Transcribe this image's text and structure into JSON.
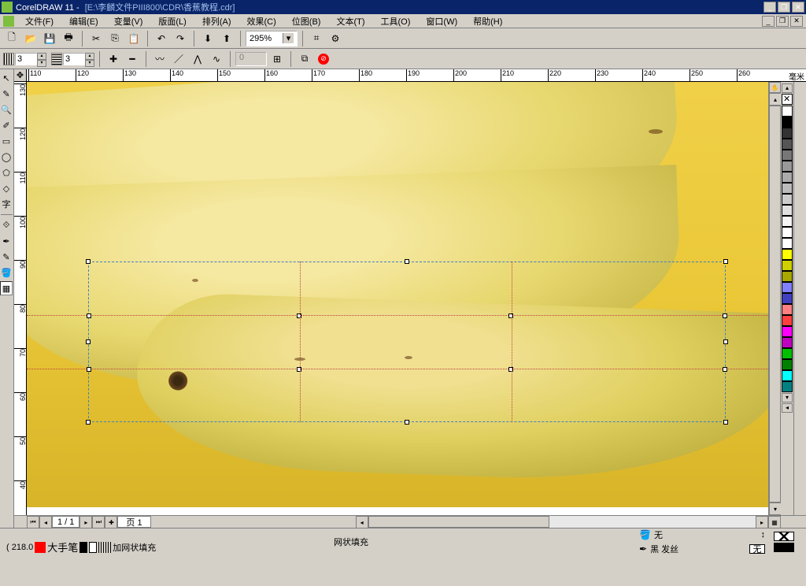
{
  "app": {
    "name": "CorelDRAW 11",
    "document_path": "[E:\\李麟文件PIII800\\CDR\\香蕉教程.cdr]"
  },
  "menu": {
    "items": [
      "文件(F)",
      "编辑(E)",
      "变量(V)",
      "版面(L)",
      "排列(A)",
      "效果(C)",
      "位图(B)",
      "文本(T)",
      "工具(O)",
      "窗口(W)",
      "帮助(H)"
    ]
  },
  "toolbar1": {
    "zoom": "295%"
  },
  "toolbar2": {
    "grid_a": "3",
    "grid_b": "3",
    "coord": "0"
  },
  "ruler": {
    "unit": "毫米",
    "h_ticks": [
      110,
      120,
      130,
      140,
      150,
      160,
      170,
      180,
      190,
      200,
      210,
      220,
      230,
      240,
      250,
      260
    ],
    "v_ticks": [
      130,
      120,
      110,
      100,
      90,
      80,
      70,
      60,
      50,
      40
    ]
  },
  "nav": {
    "page_current": "1",
    "page_total": "1",
    "page_tab": "页 1"
  },
  "status": {
    "coord": "( 218.0",
    "bigtext": "大手笔",
    "meshfill_label": "加网状填充",
    "center": "网状填充",
    "fill": "无",
    "outline": "黑 发丝",
    "outline_box": "无"
  },
  "palette": {
    "colors": [
      "#FFFFFF",
      "#000000",
      "#333333",
      "#555555",
      "#777777",
      "#999999",
      "#AAAAAA",
      "#BBBBBB",
      "#CCCCCC",
      "#E0E0E0",
      "#F5F5F5",
      "#FFFFFF",
      "#FFFFFF",
      "#FFFF00",
      "#D0D000",
      "#A8A800",
      "#8080FF",
      "#4040C0",
      "#FF8080",
      "#FF4040",
      "#FF00FF",
      "#C000C0",
      "#00C000",
      "#008000",
      "#00FFFF",
      "#008080"
    ]
  }
}
